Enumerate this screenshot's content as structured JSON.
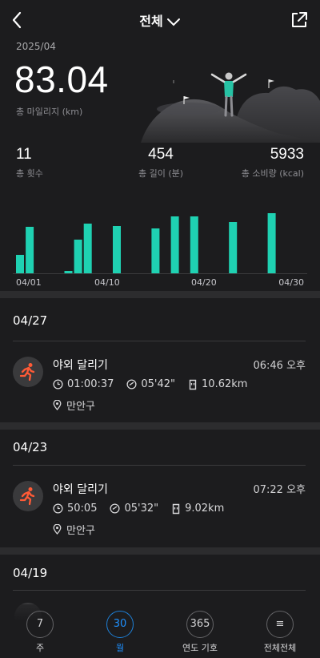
{
  "header": {
    "title": "전체"
  },
  "summary": {
    "period": "2025/04",
    "mileage_value": "83.04",
    "mileage_label": "총 마일리지 (km)",
    "stats": [
      {
        "value": "11",
        "label": "총 횟수"
      },
      {
        "value": "454",
        "label": "총 길이 (분)"
      },
      {
        "value": "5933",
        "label": "총 소비량 (kcal)"
      }
    ]
  },
  "chart_data": {
    "type": "bar",
    "color": "#1fd1b2",
    "x_tick_labels": [
      "04/01",
      "04/10",
      "04/20",
      "04/30"
    ],
    "tick_days": [
      1,
      10,
      20,
      30
    ],
    "days": [
      1,
      2,
      6,
      7,
      8,
      11,
      15,
      17,
      19,
      23,
      27
    ],
    "values": [
      2.3,
      5.8,
      0.3,
      4.2,
      6.2,
      5.9,
      5.6,
      7.1,
      7.1,
      6.4,
      7.5
    ],
    "ylim": [
      0,
      8
    ]
  },
  "sections": [
    {
      "date": "04/27",
      "runs": [
        {
          "title": "야외 달리기",
          "time": "06:46 오후",
          "duration": "01:00:37",
          "pace": "05'42\"",
          "distance": "10.62km",
          "location": "만안구"
        }
      ]
    },
    {
      "date": "04/23",
      "runs": [
        {
          "title": "야외 달리기",
          "time": "07:22 오후",
          "duration": "50:05",
          "pace": "05'32\"",
          "distance": "9.02km",
          "location": "만안구"
        }
      ]
    },
    {
      "date": "04/19",
      "runs": []
    }
  ],
  "tabs": [
    {
      "icon_text": "7",
      "label": "주",
      "active": false
    },
    {
      "icon_text": "30",
      "label": "월",
      "active": true
    },
    {
      "icon_text": "365",
      "label": "연도 기호",
      "active": false
    },
    {
      "icon_text": "≡",
      "label": "전체전체",
      "active": false
    }
  ],
  "colors": {
    "accent": "#1fd1b2",
    "active_tab": "#1e90ff",
    "run_icon": "#ff5a36",
    "background": "#1c1c1e"
  }
}
